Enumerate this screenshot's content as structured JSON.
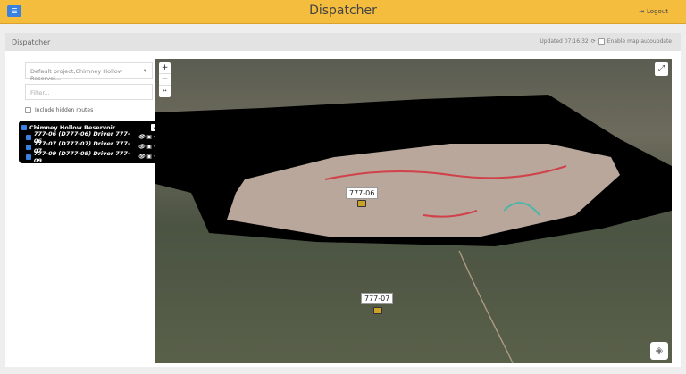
{
  "header": {
    "title": "Dispatcher",
    "menu_icon": "hamburger-icon",
    "logout_label": "Logout",
    "logout_icon": "sign-out-icon"
  },
  "panel": {
    "title": "Dispatcher",
    "updated": "Updated 07:16:32",
    "refresh_icon": "refresh-icon",
    "autoupdate_label": "Enable map autoupdate",
    "autoupdate_checked": false
  },
  "sidebar": {
    "project_select": "Default project,Chimney Hollow Reservoi...",
    "filter_placeholder": "Filter...",
    "include_hidden_label": "Include hidden routes",
    "group": {
      "name": "Chimney Hollow Reservoir",
      "checked": true,
      "items": [
        {
          "label": "777-06 (D777-06) Driver 777-06",
          "checked": true
        },
        {
          "label": "777-07 (D777-07) Driver 777-07",
          "checked": true
        },
        {
          "label": "777-09 (D777-09) Driver 777-09",
          "checked": true
        }
      ]
    }
  },
  "map": {
    "zoom_in": "+",
    "zoom_out": "−",
    "reset": "↔",
    "markers": [
      {
        "label": "777-06"
      },
      {
        "label": "777-07"
      }
    ]
  }
}
